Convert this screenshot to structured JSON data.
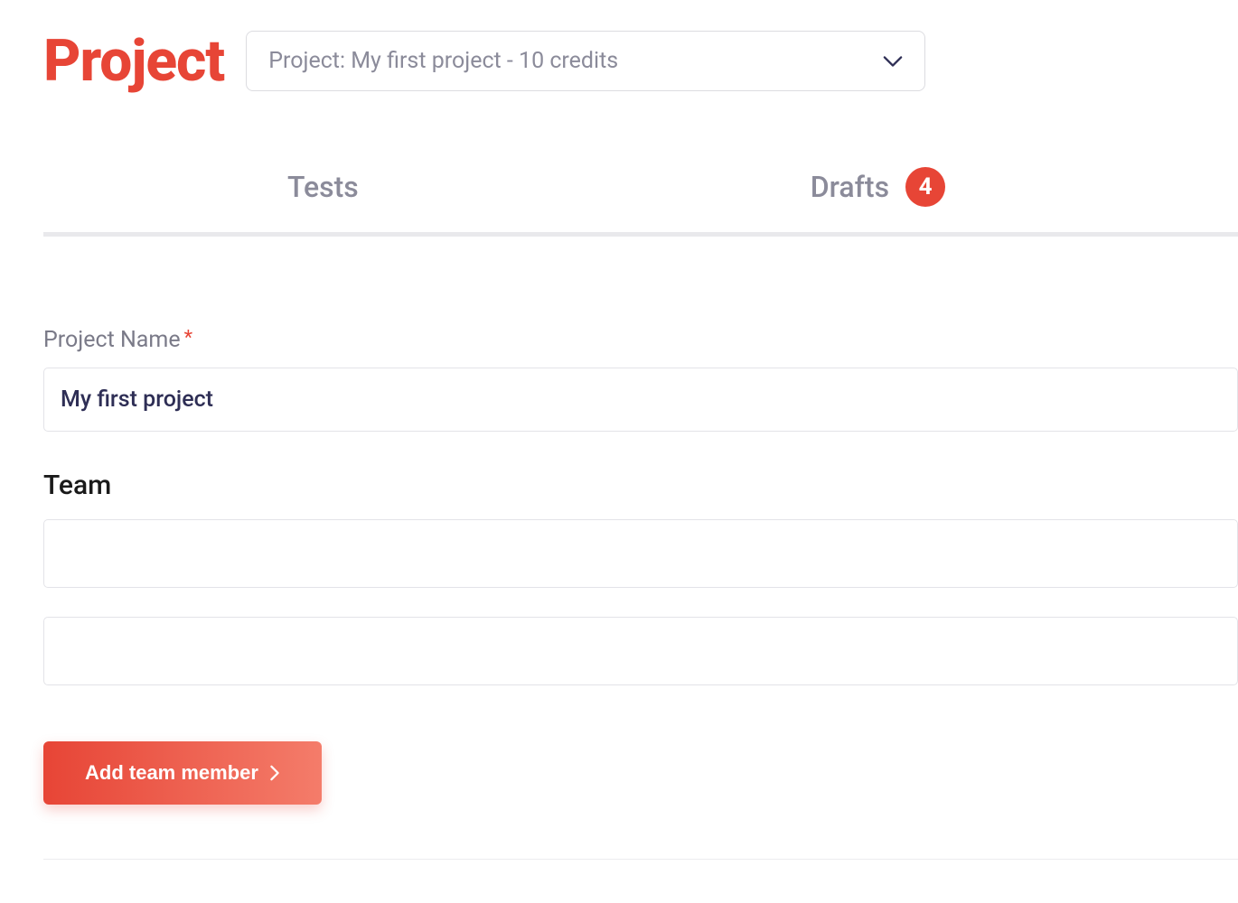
{
  "header": {
    "title": "Project",
    "selector_text": "Project: My first project - 10 credits"
  },
  "tabs": {
    "tests": {
      "label": "Tests"
    },
    "drafts": {
      "label": "Drafts",
      "badge": "4"
    }
  },
  "form": {
    "project_name_label": "Project Name",
    "project_name_value": "My first project",
    "team_heading": "Team",
    "team_member_1_value": "",
    "team_member_2_value": "",
    "add_button_label": "Add team member"
  },
  "colors": {
    "accent": "#e74536",
    "gradient_end": "#f47c6a",
    "text_muted": "#8b8b9a",
    "text_dark": "#2d2d3a",
    "border": "#e3e3e8"
  }
}
